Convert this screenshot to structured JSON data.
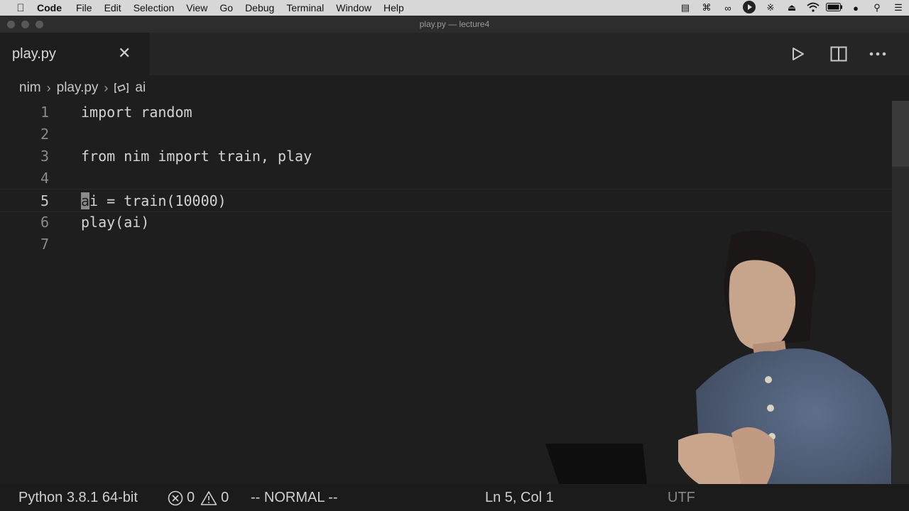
{
  "menubar": {
    "app_name": "Code",
    "items": [
      "File",
      "Edit",
      "Selection",
      "View",
      "Go",
      "Debug",
      "Terminal",
      "Window",
      "Help"
    ]
  },
  "window": {
    "title": "play.py — lecture4"
  },
  "tab": {
    "title": "play.py"
  },
  "breadcrumb": {
    "folder": "nim",
    "file": "play.py",
    "symbol": "ai"
  },
  "editor": {
    "lines": [
      {
        "number": "1",
        "code": "import random"
      },
      {
        "number": "2",
        "code": ""
      },
      {
        "number": "3",
        "code": "from nim import train, play"
      },
      {
        "number": "4",
        "code": ""
      },
      {
        "number": "5",
        "code_cursor": "a",
        "code_rest": "i = train(10000)"
      },
      {
        "number": "6",
        "code": "play(ai)"
      },
      {
        "number": "7",
        "code": ""
      }
    ]
  },
  "statusbar": {
    "interpreter": "Python 3.8.1 64-bit",
    "errors": "0",
    "warnings": "0",
    "mode": "-- NORMAL --",
    "position": "Ln 5, Col 1",
    "encoding": "UTF"
  },
  "colors": {
    "editor_bg": "#1e1e1e",
    "tabbar_bg": "#252526",
    "menubar_bg": "#d7d7d7"
  }
}
